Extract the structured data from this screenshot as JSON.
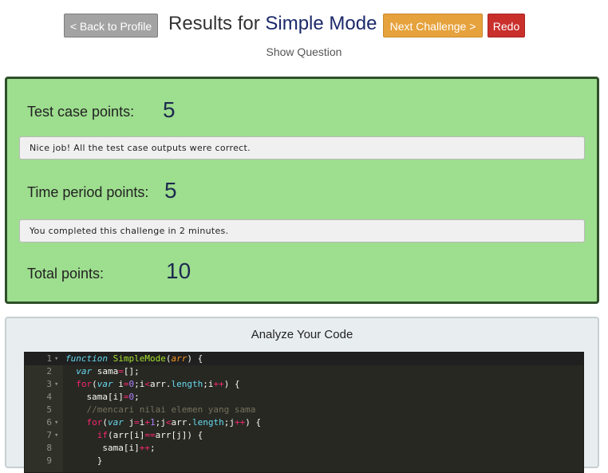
{
  "header": {
    "back_label": "< Back to Profile",
    "title_prefix": "Results for",
    "title_mode": "Simple Mode",
    "next_label": "Next Challenge >",
    "redo_label": "Redo",
    "show_question": "Show Question"
  },
  "points": {
    "test_case_label": "Test case points:",
    "test_case_value": "5",
    "test_case_message": "Nice job! All the test case outputs were correct.",
    "time_period_label": "Time period points:",
    "time_period_value": "5",
    "time_period_message": "You completed this challenge in 2 minutes.",
    "total_label": "Total points:",
    "total_value": "10"
  },
  "analyze": {
    "title": "Analyze Your Code",
    "line_numbers": [
      "1",
      "2",
      "3",
      "4",
      "5",
      "6",
      "7",
      "8",
      "9"
    ],
    "code_lines": [
      "function SimpleMode(arr) {",
      "  var sama=[];",
      "  for(var i=0;i<arr.length;i++) {",
      "    sama[i]=0;",
      "    //mencari nilai elemen yang sama",
      "    for(var j=i+1;j<arr.length;j++) {",
      "      if(arr[i]==arr[j]) {",
      "       sama[i]++;",
      "      }"
    ]
  },
  "colors": {
    "points_panel_bg": "#9ede8f",
    "next_button": "#e6a23c",
    "redo_button": "#c9302c",
    "back_button": "#a3a3a3",
    "editor_bg": "#272822"
  }
}
